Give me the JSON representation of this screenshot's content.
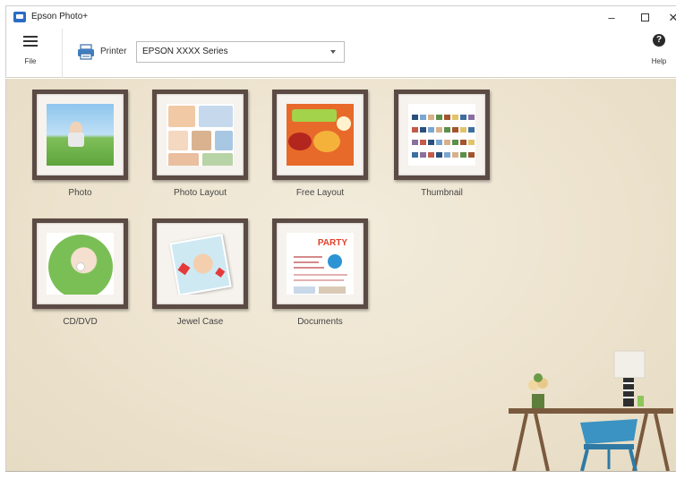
{
  "window": {
    "title": "Epson Photo+",
    "minimize": "–",
    "close": "✕"
  },
  "toolbar": {
    "file_label": "File",
    "printer_label": "Printer",
    "printer_value": "EPSON XXXX Series",
    "help_label": "Help",
    "help_glyph": "?"
  },
  "tiles": [
    {
      "label": "Photo"
    },
    {
      "label": "Photo Layout"
    },
    {
      "label": "Free Layout"
    },
    {
      "label": "Thumbnail"
    },
    {
      "label": "CD/DVD"
    },
    {
      "label": "Jewel Case"
    },
    {
      "label": "Documents"
    }
  ],
  "documents_art": {
    "heading": "PARTY"
  },
  "colors": {
    "wall": "#ece2cd",
    "frame": "#5b4b44",
    "accent": "#2b6cc4"
  }
}
